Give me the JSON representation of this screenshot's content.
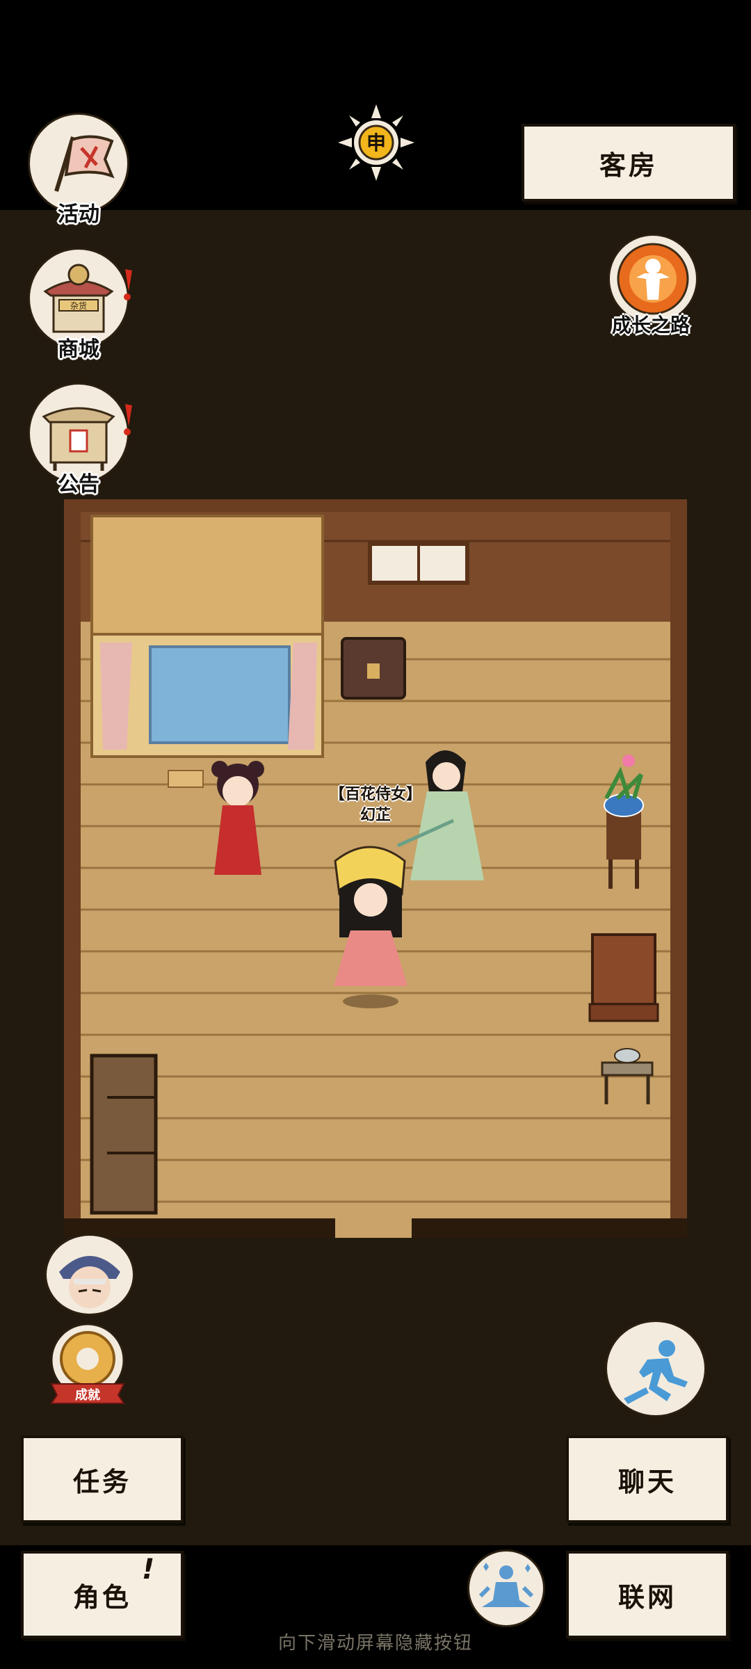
{
  "top_left_buttons": [
    {
      "label": "活动",
      "icon": "flag-icon"
    },
    {
      "label": "商城",
      "icon": "shop-icon",
      "sign": "杂货",
      "badge": "!"
    },
    {
      "label": "公告",
      "icon": "notice-board-icon",
      "badge": "!"
    }
  ],
  "time_indicator": {
    "symbol": "申",
    "icon": "sun-icon"
  },
  "location": {
    "label": "客房"
  },
  "growth": {
    "label": "成长之路",
    "icon": "growth-path-icon"
  },
  "npc": {
    "title": "【百花侍女】",
    "name": "幻芷"
  },
  "achievement": {
    "ribbon": "成就",
    "icon": "achievement-medal-icon"
  },
  "companion": {
    "icon": "companion-portrait-icon"
  },
  "run": {
    "icon": "run-icon"
  },
  "meditate": {
    "icon": "meditate-icon"
  },
  "buttons": {
    "task": "任务",
    "chat": "聊天",
    "role": "角色",
    "role_badge": "!",
    "network": "联网"
  },
  "hint": "向下滑动屏幕隐藏按钮",
  "colors": {
    "background": "#221a0e",
    "paper": "#f5efe2",
    "floor": "#c9a36a",
    "wall": "#6b3e22",
    "alert": "#d62a1a"
  }
}
